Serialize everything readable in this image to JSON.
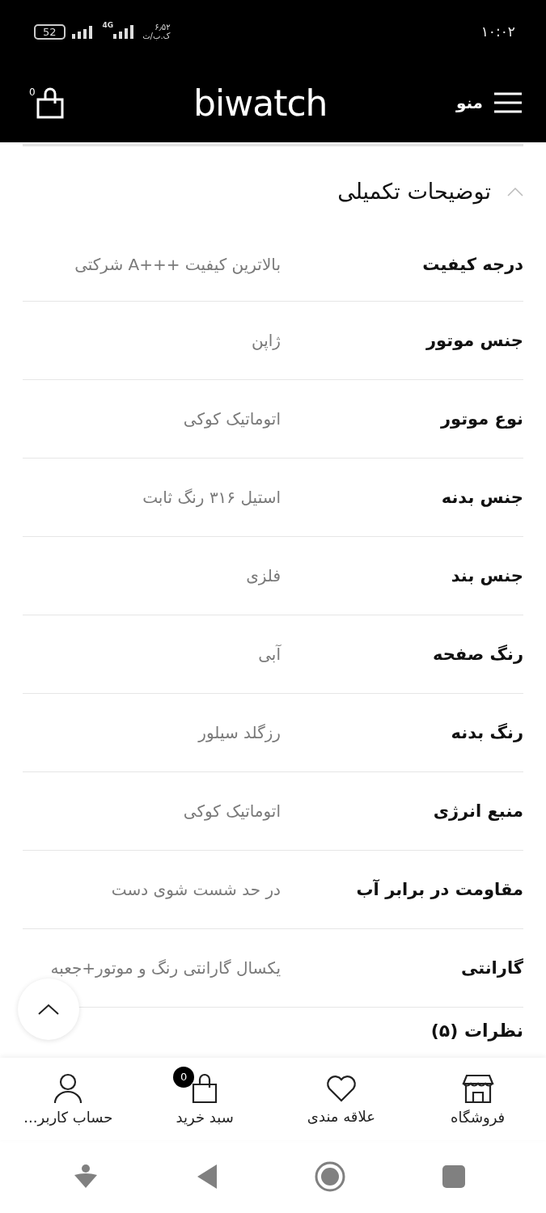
{
  "status_bar": {
    "battery": "52",
    "network": "4G",
    "speed": "۶٫۵۲",
    "speed_unit": "ک.ب/ث",
    "time": "۱۰:۰۲"
  },
  "header": {
    "menu_label": "منو",
    "logo": "biwatch",
    "cart_count": "0"
  },
  "section": {
    "title": "توضیحات تکمیلی",
    "expanded": true,
    "rows": [
      {
        "label": "درجه کیفیت",
        "value": "بالاترین کیفیت +++A شرکتی"
      },
      {
        "label": "جنس موتور",
        "value": "ژاپن"
      },
      {
        "label": "نوع موتور",
        "value": "اتوماتیک کوکی"
      },
      {
        "label": "جنس بدنه",
        "value": "استیل ۳۱۶ رنگ ثابت"
      },
      {
        "label": "جنس بند",
        "value": "فلزی"
      },
      {
        "label": "رنگ صفحه",
        "value": "آبی"
      },
      {
        "label": "رنگ بدنه",
        "value": "رزگلد سیلور"
      },
      {
        "label": "منبع انرژی",
        "value": "اتوماتیک کوکی"
      },
      {
        "label": "مقاومت در برابر آب",
        "value": "در حد شست شوی دست"
      },
      {
        "label": "گارانتی",
        "value": "یکسال گارانتی رنگ و موتور+جعبه"
      }
    ]
  },
  "next_section": {
    "title": "نظرات (۵)"
  },
  "bottom_nav": [
    {
      "kind": "store",
      "label": "فروشگاه"
    },
    {
      "kind": "heart",
      "label": "علاقه مندی"
    },
    {
      "kind": "cart",
      "label": "سبد خرید",
      "badge": "0"
    },
    {
      "kind": "user",
      "label": "حساب کاربر..."
    }
  ]
}
